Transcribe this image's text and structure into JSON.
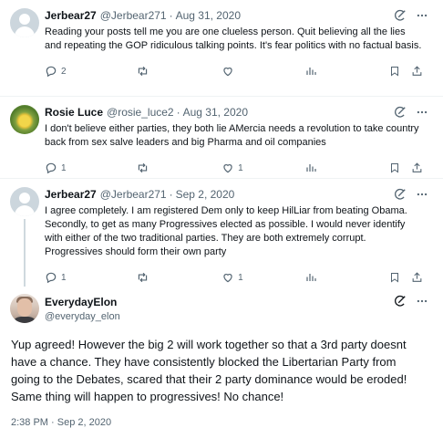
{
  "replies": [
    {
      "name": "Jerbear27",
      "handle": "@Jerbear271",
      "date": "Aug 31, 2020",
      "text": "Reading your posts tell me you are one clueless person. Quit believing all the lies and repeating the GOP ridiculous talking points. It's fear politics with no factual basis.",
      "reply_count": "2",
      "retweet_count": "",
      "like_count": "",
      "avatar": "default-avatar"
    },
    {
      "name": "Rosie Luce",
      "handle": "@rosie_luce2",
      "date": "Aug 31, 2020",
      "text": "I don't believe either parties, they both lie AMercia needs a revolution to take country back from sex salve leaders and big Pharma and oil companies",
      "reply_count": "1",
      "retweet_count": "",
      "like_count": "1",
      "avatar": "flower-avatar"
    },
    {
      "name": "Jerbear27",
      "handle": "@Jerbear271",
      "date": "Sep 2, 2020",
      "text": "I agree completely. I am registered Dem only to keep HilLiar from beating Obama. Secondly, to get as many Progressives elected as possible. I would never identify with either of the two traditional parties. They are both extremely corrupt. Progressives should form their own party",
      "reply_count": "1",
      "retweet_count": "",
      "like_count": "1",
      "avatar": "default-avatar"
    }
  ],
  "main_post": {
    "name": "EverydayElon",
    "handle": "@everyday_elon",
    "text": "Yup agreed! However the big 2 will work together so that a 3rd party doesnt have a chance. They have consistently blocked the Libertarian Party from going to the Debates, scared that their 2 party dominance would be eroded! Same thing will happen to progressives! No chance!",
    "timestamp": "2:38 PM · Sep 2, 2020"
  },
  "icons": {
    "grok": "grok-icon",
    "more": "more-icon",
    "reply": "reply-icon",
    "retweet": "retweet-icon",
    "like": "like-icon",
    "views": "views-icon",
    "bookmark": "bookmark-icon",
    "share": "share-icon"
  },
  "colors": {
    "text": "#0f1419",
    "secondary": "#536471",
    "divider": "#eff3f4",
    "thread_line": "#cfd9de"
  }
}
